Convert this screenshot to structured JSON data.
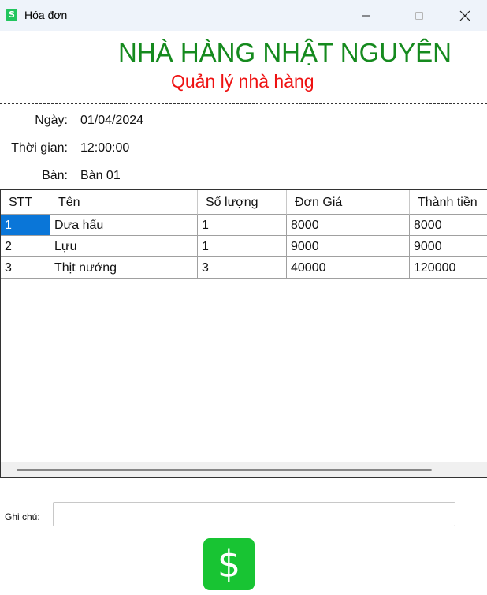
{
  "window": {
    "title": "Hóa đơn",
    "icon": "app-icon",
    "icon_glyph": "S"
  },
  "header": {
    "title": "NHÀ HÀNG NHẬT NGUYÊN",
    "subtitle": "Quản lý nhà hàng",
    "title_color": "#158a1e",
    "subtitle_color": "#ee1111"
  },
  "info": {
    "date_label": "Ngày:",
    "date_value": "01/04/2024",
    "time_label": "Thời gian:",
    "time_value": "12:00:00",
    "table_label": "Bàn:",
    "table_value": "Bàn 01"
  },
  "grid": {
    "columns": [
      "STT",
      "Tên",
      "Số lượng",
      "Đơn Giá",
      "Thành tiền"
    ],
    "rows": [
      [
        "1",
        "Dưa hấu",
        "1",
        "8000",
        "8000"
      ],
      [
        "2",
        "Lựu",
        "1",
        "9000",
        "9000"
      ],
      [
        "3",
        "Thịt nướng",
        "3",
        "40000",
        "120000"
      ]
    ],
    "selected_cell": {
      "row": 0,
      "column": 0
    }
  },
  "note": {
    "label": "Ghi chú:",
    "value": ""
  },
  "pay_button": {
    "glyph": "$",
    "icon": "dollar-icon",
    "color": "#18c433"
  }
}
